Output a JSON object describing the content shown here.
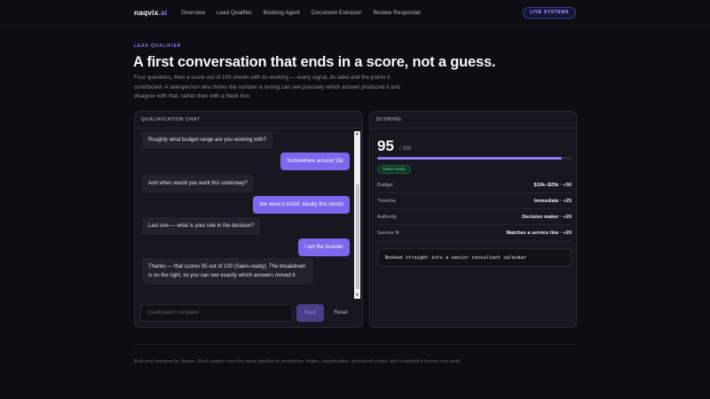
{
  "nav": {
    "logo_main": "naqvix",
    "logo_suffix": ".ai",
    "links": [
      "Overview",
      "Lead Qualifier",
      "Booking Agent",
      "Document Extractor",
      "Review Responder"
    ],
    "badge": "LIVE SYSTEMS"
  },
  "hero": {
    "eyebrow": "LEAD QUALIFIER",
    "title": "A first conversation that ends in a score, not a guess.",
    "description": "Four questions, then a score out of 100 shown with its working — every signal, its label and the points it contributed. A salesperson who thinks the number is wrong can see precisely which answer produced it and disagree with that, rather than with a black box."
  },
  "chat": {
    "header": "QUALIFICATION CHAT",
    "messages": [
      {
        "from": "bot",
        "text": "Roughly what budget range are you working with?"
      },
      {
        "from": "user",
        "text": "Somewhere around 15k"
      },
      {
        "from": "bot",
        "text": "And when would you want this underway?"
      },
      {
        "from": "user",
        "text": "We need it ASAP, ideally this month"
      },
      {
        "from": "bot",
        "text": "Last one — what is your role in the decision?"
      },
      {
        "from": "user",
        "text": "I am the founder"
      },
      {
        "from": "bot",
        "text": "Thanks — that scores 95 out of 100 (Sales-ready). The breakdown is on the right, so you can see exactly which answers moved it."
      }
    ],
    "input_placeholder": "Qualification complete",
    "send_label": "Send",
    "reset_label": "Reset"
  },
  "scoring": {
    "header": "SCORING",
    "score": "95",
    "max": "/ 100",
    "fill_percent": 95,
    "status": "Sales-ready",
    "rows": [
      {
        "label": "Budget",
        "value": "$10k–$25k · +30"
      },
      {
        "label": "Timeline",
        "value": "Immediate · +25"
      },
      {
        "label": "Authority",
        "value": "Decision maker · +20"
      },
      {
        "label": "Service fit",
        "value": "Matches a service line · +20"
      }
    ],
    "handoff": "Booked straight into a senior consultant calendar"
  },
  "footer": "Built and operated by Naqvix. Each system runs the same pipeline in production: intake, classification, structured output, and a handoff a human can audit.",
  "colors": {
    "accent": "#8b7cf6",
    "user_bubble": "#7a68ee",
    "success": "#5fd69a",
    "background": "#0d0d13"
  }
}
